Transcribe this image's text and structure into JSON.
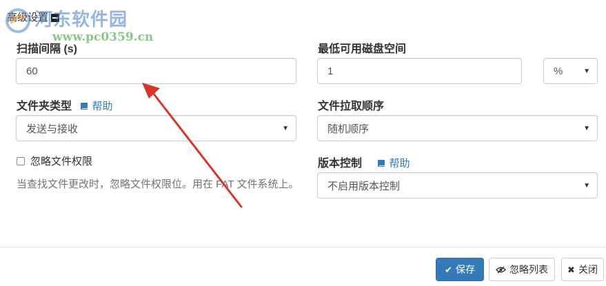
{
  "section": {
    "title": "高级设置"
  },
  "watermark": {
    "name": "河东软件园",
    "url": "www.pc0359.cn"
  },
  "scan_interval": {
    "label": "扫描间隔 (s)",
    "value": "60"
  },
  "min_disk_space": {
    "label": "最低可用磁盘空间",
    "value": "1",
    "unit": "%"
  },
  "folder_type": {
    "label": "文件夹类型",
    "help": "帮助",
    "value": "发送与接收"
  },
  "pull_order": {
    "label": "文件拉取顺序",
    "value": "随机顺序"
  },
  "ignore_perms": {
    "label": "忽略文件权限",
    "checked": false,
    "description": "当查找文件更改时，忽略文件权限位。用在 FAT 文件系统上。"
  },
  "versioning": {
    "label": "版本控制",
    "help": "帮助",
    "value": "不启用版本控制"
  },
  "footer": {
    "save": "保存",
    "ignore_list": "忽略列表",
    "close": "关闭"
  },
  "colors": {
    "primary": "#337ab7",
    "arrow": "#d9342b"
  },
  "icons": {
    "collapse": "minus-square-icon",
    "help": "book-icon",
    "save": "check-icon",
    "ignore": "eye-slash-icon",
    "close": "times-icon"
  }
}
